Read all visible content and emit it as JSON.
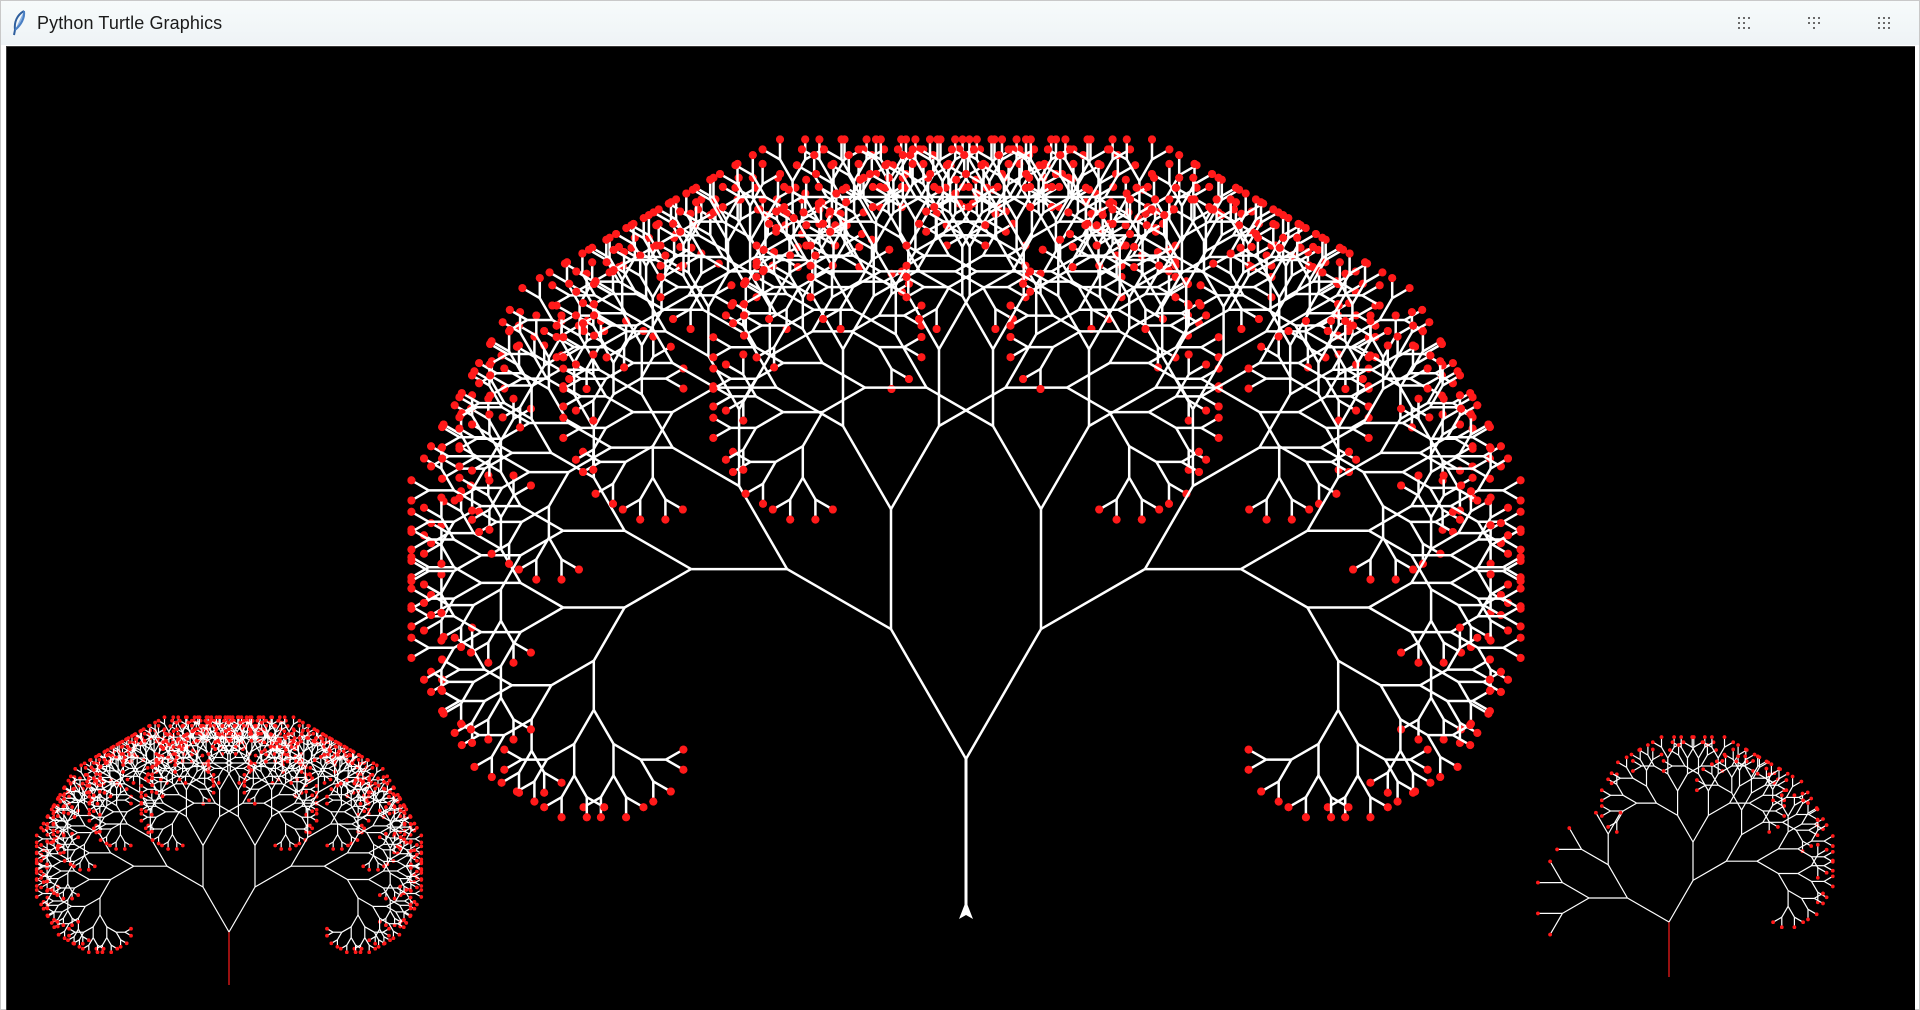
{
  "window": {
    "title": "Python Turtle Graphics",
    "icon": "feather-icon"
  },
  "titlebar_controls": [
    {
      "name": "minimize-button",
      "icon": "dots-grid-icon"
    },
    {
      "name": "maximize-button",
      "icon": "dots-grid-icon"
    },
    {
      "name": "close-button",
      "icon": "dots-grid-icon"
    }
  ],
  "canvas": {
    "background": "#000000",
    "branch_color": "#ffffff",
    "leaf_color": "#ff1a1a",
    "turtle_color": "#ffffff",
    "secondary_stroke_colors": [
      "#ff1a1a",
      "#1db31d",
      "#ffd400"
    ]
  },
  "trees": [
    {
      "name": "main-fractal-tree",
      "depth": 10
    },
    {
      "name": "left-small-fractal-tree",
      "depth": 10
    },
    {
      "name": "right-small-fractal-tree",
      "depth": 8
    }
  ]
}
